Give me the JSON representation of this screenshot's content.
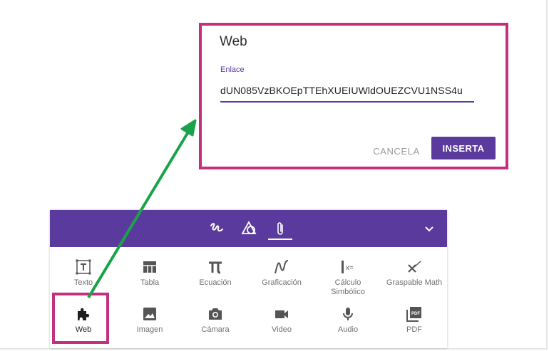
{
  "dialog": {
    "title": "Web",
    "field_label": "Enlace",
    "field_value": "dUN085VzBKOEpTTEhXUEIUWldOUEZCVU1NSS4u",
    "cancel_label": "CANCELA",
    "insert_label": "INSERTA"
  },
  "toolbar": {
    "header_icons": [
      "freehand-icon",
      "shapes-icon",
      "attachment-icon"
    ],
    "active_tab": "attachment-icon",
    "collapse_icon": "chevron-down-icon",
    "accent_color": "#5b3a9e",
    "items": [
      {
        "label": "Texto",
        "icon": "text-box-icon"
      },
      {
        "label": "Tabla",
        "icon": "table-icon"
      },
      {
        "label": "Ecuación",
        "icon": "equation-icon"
      },
      {
        "label": "Graficación",
        "icon": "graph-icon"
      },
      {
        "label": "Cálculo Simbólico",
        "icon": "symbolic-calc-icon"
      },
      {
        "label": "Graspable Math",
        "icon": "graspable-math-icon"
      },
      {
        "label": "Web",
        "icon": "puzzle-icon"
      },
      {
        "label": "Imagen",
        "icon": "image-icon"
      },
      {
        "label": "Cámara",
        "icon": "camera-icon"
      },
      {
        "label": "Video",
        "icon": "video-icon"
      },
      {
        "label": "Audio",
        "icon": "microphone-icon"
      },
      {
        "label": "PDF",
        "icon": "pdf-icon"
      }
    ]
  },
  "highlight_color": "#c2307f",
  "arrow_color": "#1aa34a"
}
